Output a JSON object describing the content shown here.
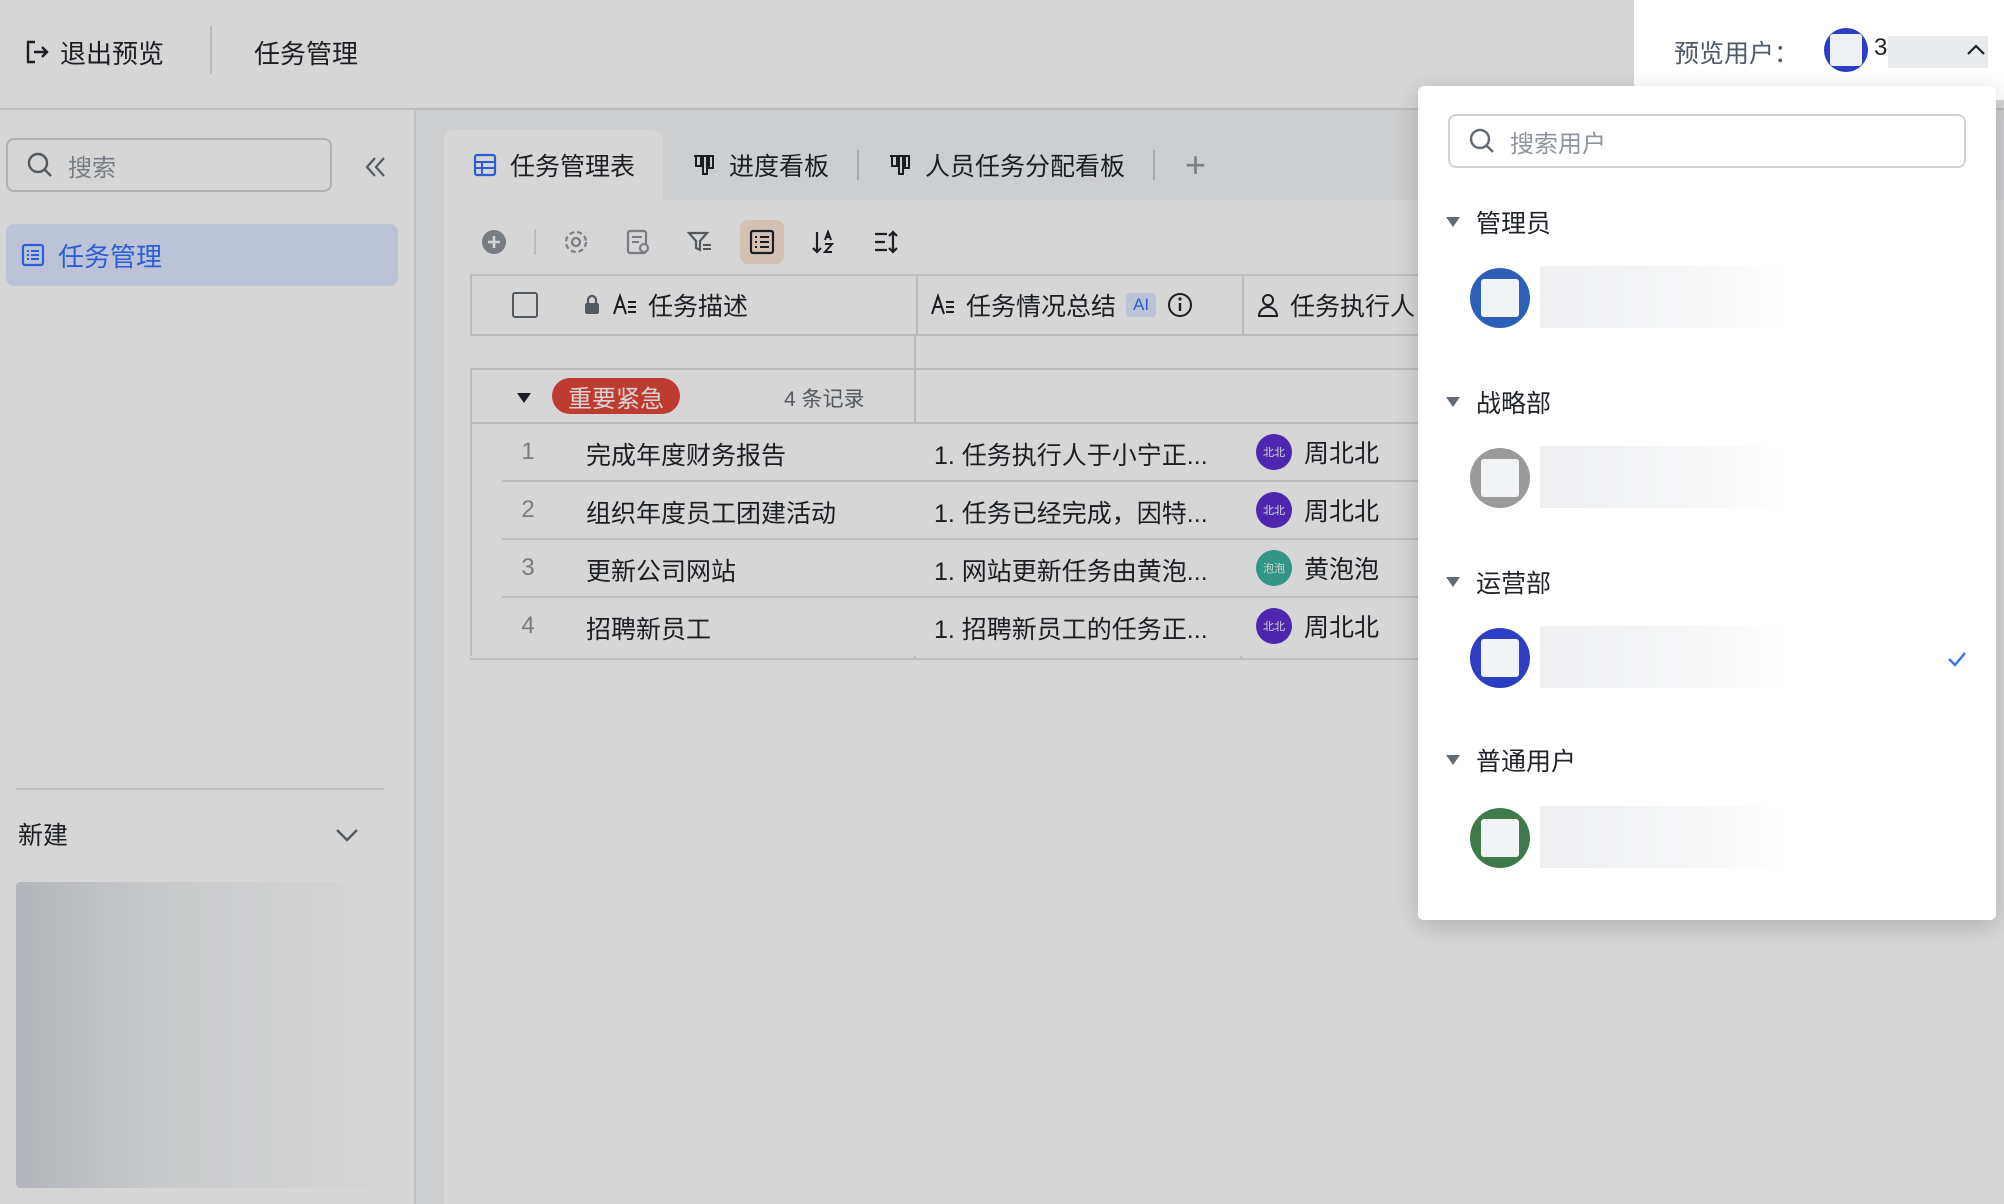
{
  "topbar": {
    "exit_label": "退出预览",
    "title": "任务管理",
    "preview_label": "预览用户：",
    "preview_user_initial": "3"
  },
  "sidebar": {
    "search_placeholder": "搜索",
    "items": [
      {
        "label": "任务管理",
        "active": true
      }
    ],
    "new_label": "新建"
  },
  "tabs": [
    {
      "label": "任务管理表",
      "icon": "table-icon",
      "active": true
    },
    {
      "label": "进度看板",
      "icon": "kanban-icon",
      "active": false
    },
    {
      "label": "人员任务分配看板",
      "icon": "kanban-icon",
      "active": false
    }
  ],
  "tab_add": "+",
  "toolbar": [
    "add-icon",
    "settings-icon",
    "form-icon",
    "filter-icon",
    "list-view-icon",
    "sort-icon",
    "row-height-icon"
  ],
  "table": {
    "columns": [
      {
        "label": "任务描述",
        "locked": true
      },
      {
        "label": "任务情况总结",
        "ai_badge": "AI"
      },
      {
        "label": "任务执行人"
      }
    ],
    "group": {
      "label": "重要紧急",
      "count": "4 条记录"
    },
    "rows": [
      {
        "num": "1",
        "task": "完成年度财务报告",
        "summary": "1. 任务执行人于小宁正...",
        "person": "周北北",
        "avatar_text": "北北",
        "avatar_color": "#5b2fd0"
      },
      {
        "num": "2",
        "task": "组织年度员工团建活动",
        "summary": "1. 任务已经完成，因特...",
        "person": "周北北",
        "avatar_text": "北北",
        "avatar_color": "#5b2fd0"
      },
      {
        "num": "3",
        "task": "更新公司网站",
        "summary": "1. 网站更新任务由黄泡...",
        "person": "黄泡泡",
        "avatar_text": "泡泡",
        "avatar_color": "#3bb29c"
      },
      {
        "num": "4",
        "task": "招聘新员工",
        "summary": "1. 招聘新员工的任务正...",
        "person": "周北北",
        "avatar_text": "北北",
        "avatar_color": "#5b2fd0"
      }
    ]
  },
  "dropdown": {
    "search_placeholder": "搜索用户",
    "groups": [
      {
        "label": "管理员",
        "avatar_color": "#2e5fb8",
        "selected": false
      },
      {
        "label": "战略部",
        "avatar_color": "#9a9a9a",
        "selected": false
      },
      {
        "label": "运营部",
        "avatar_color": "#2c3ec4",
        "selected": true
      },
      {
        "label": "普通用户",
        "avatar_color": "#3f7a4a",
        "selected": false
      }
    ]
  },
  "colors": {
    "accent": "#3370ff",
    "urgent_tag": "#e2473a"
  }
}
